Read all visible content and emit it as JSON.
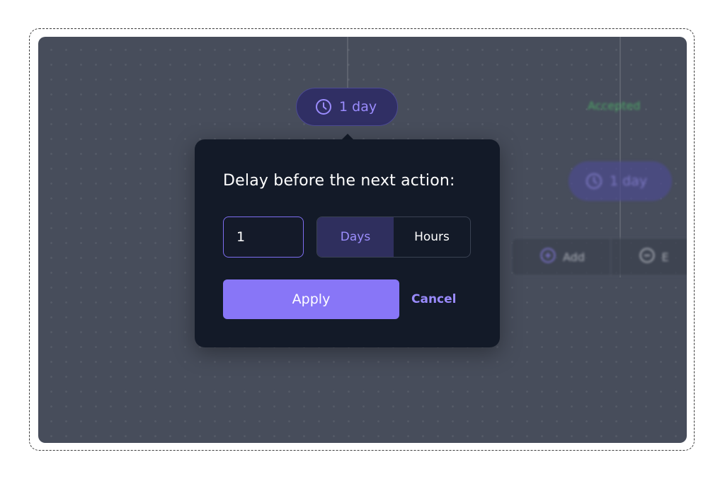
{
  "workflow": {
    "top_delay_label": "1 day",
    "status_label": "Accepted",
    "right_delay_label": "1 day",
    "action_bar": {
      "add_label": "Add",
      "end_label": "E"
    }
  },
  "delay_popover": {
    "title": "Delay before the next action:",
    "amount_value": "1",
    "units": [
      {
        "label": "Days",
        "selected": true
      },
      {
        "label": "Hours",
        "selected": false
      }
    ],
    "apply_label": "Apply",
    "cancel_label": "Cancel"
  },
  "colors": {
    "accent": "#8876f7",
    "accent_text": "#9a8bff",
    "accepted_green": "#4fc26a",
    "popover_bg": "#131a28",
    "canvas_bg": "#474d5b"
  }
}
